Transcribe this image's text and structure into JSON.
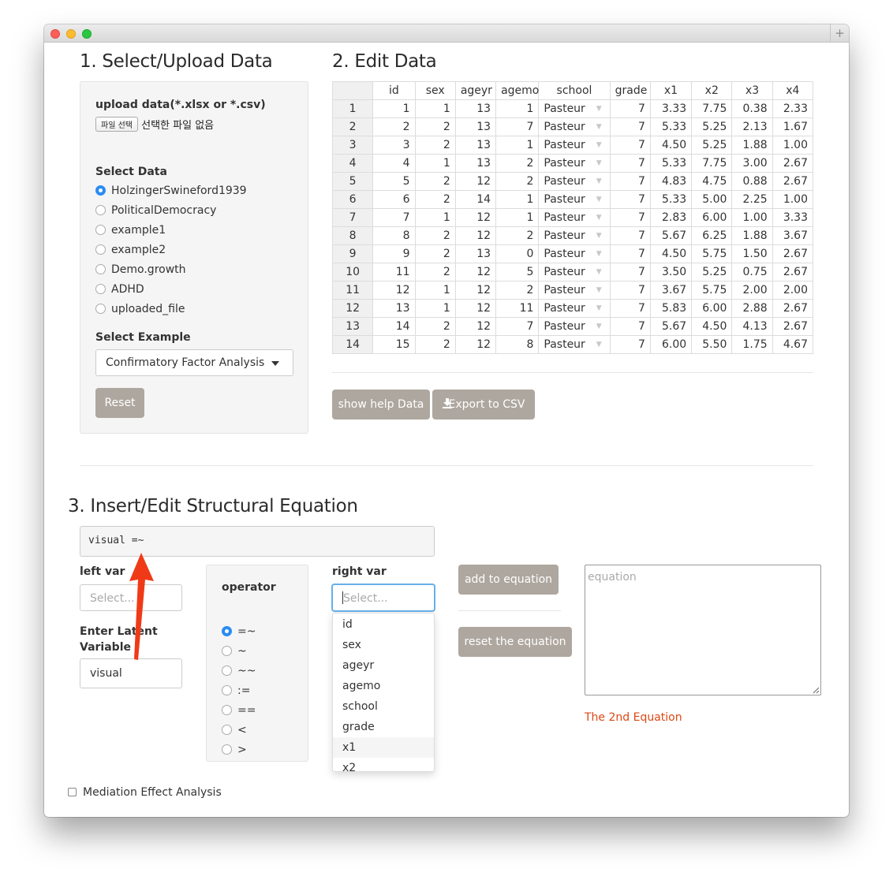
{
  "window": {
    "new_tab": "+"
  },
  "section1": {
    "title": "1. Select/Upload Data",
    "upload_label": "upload data(*.xlsx or *.csv)",
    "file_button": "파일 선택",
    "file_status": "선택한 파일 없음",
    "select_data_label": "Select Data",
    "datasets": [
      "HolzingerSwineford1939",
      "PoliticalDemocracy",
      "example1",
      "example2",
      "Demo.growth",
      "ADHD",
      "uploaded_file"
    ],
    "selected_dataset": "HolzingerSwineford1939",
    "select_example_label": "Select Example",
    "example_value": "Confirmatory Factor Analysis",
    "reset_button": "Reset"
  },
  "section2": {
    "title": "2. Edit Data",
    "columns": [
      "",
      "id",
      "sex",
      "ageyr",
      "agemo",
      "school",
      "grade",
      "x1",
      "x2",
      "x3",
      "x4"
    ],
    "rows": [
      [
        "1",
        "1",
        "1",
        "13",
        "1",
        "Pasteur",
        "7",
        "3.33",
        "7.75",
        "0.38",
        "2.33"
      ],
      [
        "2",
        "2",
        "2",
        "13",
        "7",
        "Pasteur",
        "7",
        "5.33",
        "5.25",
        "2.13",
        "1.67"
      ],
      [
        "3",
        "3",
        "2",
        "13",
        "1",
        "Pasteur",
        "7",
        "4.50",
        "5.25",
        "1.88",
        "1.00"
      ],
      [
        "4",
        "4",
        "1",
        "13",
        "2",
        "Pasteur",
        "7",
        "5.33",
        "7.75",
        "3.00",
        "2.67"
      ],
      [
        "5",
        "5",
        "2",
        "12",
        "2",
        "Pasteur",
        "7",
        "4.83",
        "4.75",
        "0.88",
        "2.67"
      ],
      [
        "6",
        "6",
        "2",
        "14",
        "1",
        "Pasteur",
        "7",
        "5.33",
        "5.00",
        "2.25",
        "1.00"
      ],
      [
        "7",
        "7",
        "1",
        "12",
        "1",
        "Pasteur",
        "7",
        "2.83",
        "6.00",
        "1.00",
        "3.33"
      ],
      [
        "8",
        "8",
        "2",
        "12",
        "2",
        "Pasteur",
        "7",
        "5.67",
        "6.25",
        "1.88",
        "3.67"
      ],
      [
        "9",
        "9",
        "2",
        "13",
        "0",
        "Pasteur",
        "7",
        "4.50",
        "5.75",
        "1.50",
        "2.67"
      ],
      [
        "10",
        "11",
        "2",
        "12",
        "5",
        "Pasteur",
        "7",
        "3.50",
        "5.25",
        "0.75",
        "2.67"
      ],
      [
        "11",
        "12",
        "1",
        "12",
        "2",
        "Pasteur",
        "7",
        "3.67",
        "5.75",
        "2.00",
        "2.00"
      ],
      [
        "12",
        "13",
        "1",
        "12",
        "11",
        "Pasteur",
        "7",
        "5.83",
        "6.00",
        "2.88",
        "2.67"
      ],
      [
        "13",
        "14",
        "2",
        "12",
        "7",
        "Pasteur",
        "7",
        "5.67",
        "4.50",
        "4.13",
        "2.67"
      ],
      [
        "14",
        "15",
        "2",
        "12",
        "8",
        "Pasteur",
        "7",
        "6.00",
        "5.50",
        "1.75",
        "4.67"
      ]
    ],
    "show_help_button": "show help Data",
    "export_button": "Export to CSV"
  },
  "section3": {
    "title": "3. Insert/Edit Structural Equation",
    "equation_preview": "visual =~",
    "left_var_label": "left var",
    "left_var_placeholder": "Select...",
    "latent_label": "Enter Latent Variable",
    "latent_value": "visual",
    "operator_label": "operator",
    "operators": [
      "=~",
      "~",
      "~~",
      ":=",
      "==",
      "<",
      ">"
    ],
    "selected_operator": "=~",
    "right_var_label": "right var",
    "right_var_placeholder": "Select...",
    "right_var_options": [
      "id",
      "sex",
      "ageyr",
      "agemo",
      "school",
      "grade",
      "x1",
      "x2"
    ],
    "highlighted_option": "x1",
    "add_button": "add to equation",
    "reset_equation_button": "reset the equation",
    "equation_placeholder": "equation",
    "equation_note": "The 2nd Equation",
    "mediation_label": "Mediation Effect Analysis"
  },
  "colors": {
    "button_grey": "#aea79f",
    "radio_blue": "#2a8cf2",
    "note_red": "#dd4814",
    "arrow_red": "#f03a17"
  }
}
